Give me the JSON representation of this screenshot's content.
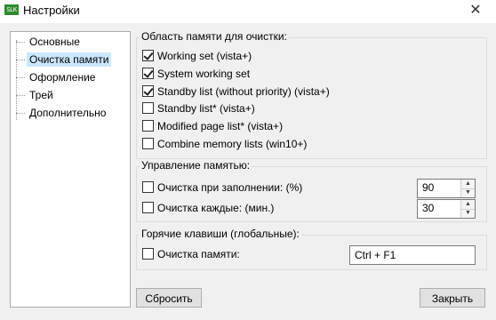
{
  "window": {
    "app_icon_text": "SLK",
    "title": "Настройки",
    "close": "✕"
  },
  "sidebar": {
    "items": [
      {
        "label": "Основные"
      },
      {
        "label": "Очистка памяти",
        "selected": true
      },
      {
        "label": "Оформление"
      },
      {
        "label": "Трей"
      },
      {
        "label": "Дополнительно"
      }
    ]
  },
  "clean_area": {
    "title": "Область памяти для очистки:",
    "options": [
      {
        "label": "Working set (vista+)",
        "checked": true
      },
      {
        "label": "System working set",
        "checked": true
      },
      {
        "label": "Standby list (without priority) (vista+)",
        "checked": true
      },
      {
        "label": "Standby list* (vista+)",
        "checked": false
      },
      {
        "label": "Modified page list* (vista+)",
        "checked": false
      },
      {
        "label": "Combine memory lists (win10+)",
        "checked": false
      }
    ]
  },
  "memory_mgmt": {
    "title": "Управление памятью:",
    "fill_label": "Очистка при заполнении: (%)",
    "fill_checked": false,
    "fill_value": "90",
    "interval_label": "Очистка каждые: (мин.)",
    "interval_checked": false,
    "interval_value": "30"
  },
  "hotkeys": {
    "title": "Горячие клавиши (глобальные):",
    "clean_label": "Очистка памяти:",
    "clean_checked": false,
    "clean_value": "Ctrl + F1"
  },
  "buttons": {
    "reset": "Сбросить",
    "close": "Закрыть"
  }
}
